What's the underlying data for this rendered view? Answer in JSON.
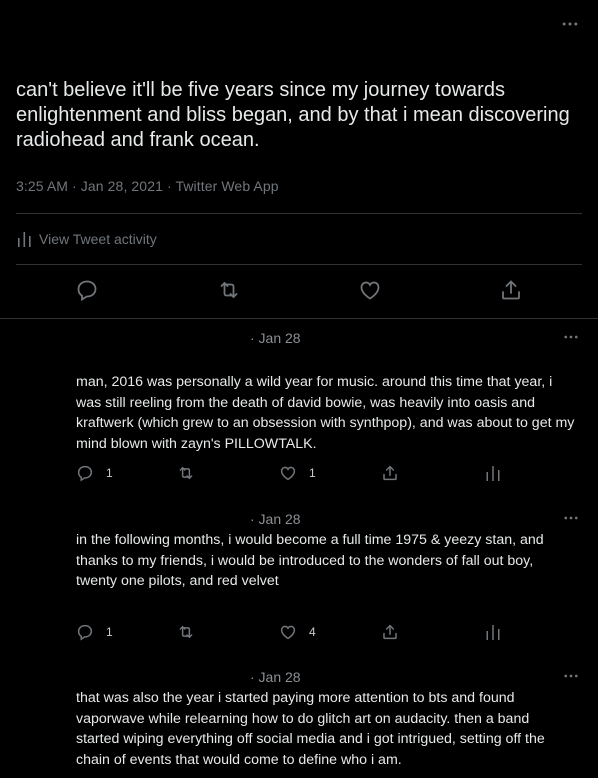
{
  "tweet": {
    "text": "can't believe it'll be five years since my journey towards enlightenment and bliss began, and by that i mean discovering radiohead and frank ocean.",
    "meta": "3:25 AM · Jan 28, 2021 · Twitter Web App",
    "activity_label": "View Tweet activity"
  },
  "replies": [
    {
      "date": "· Jan 28",
      "text": "man, 2016 was personally a wild year for music. around this time that year, i was still reeling from the death of david bowie, was heavily into oasis and kraftwerk (which grew to an obsession with synthpop), and was about to get my mind blown with zayn's PILLOWTALK.",
      "reply_count": "1",
      "like_count": "1"
    },
    {
      "date": "· Jan 28",
      "text": "in the following months, i would become a full time 1975 & yeezy stan, and thanks to my friends, i would be introduced to the wonders of fall out boy, twenty one pilots, and red velvet",
      "reply_count": "1",
      "like_count": "4"
    },
    {
      "date": "· Jan 28",
      "text": "that was also the year i started paying more attention to bts and found vaporwave while relearning how to do glitch art on audacity. then a band started wiping everything off social media and i got intrigued, setting off the chain of events that would come to define who i am."
    }
  ],
  "icons": {
    "more": "more-icon",
    "reply": "reply-icon",
    "retweet": "retweet-icon",
    "like": "like-icon",
    "share": "share-icon",
    "analytics": "analytics-icon"
  },
  "colors": {
    "background": "#000000",
    "text": "#e7e9ea",
    "secondary": "#71767b",
    "divider": "#2f3336"
  }
}
